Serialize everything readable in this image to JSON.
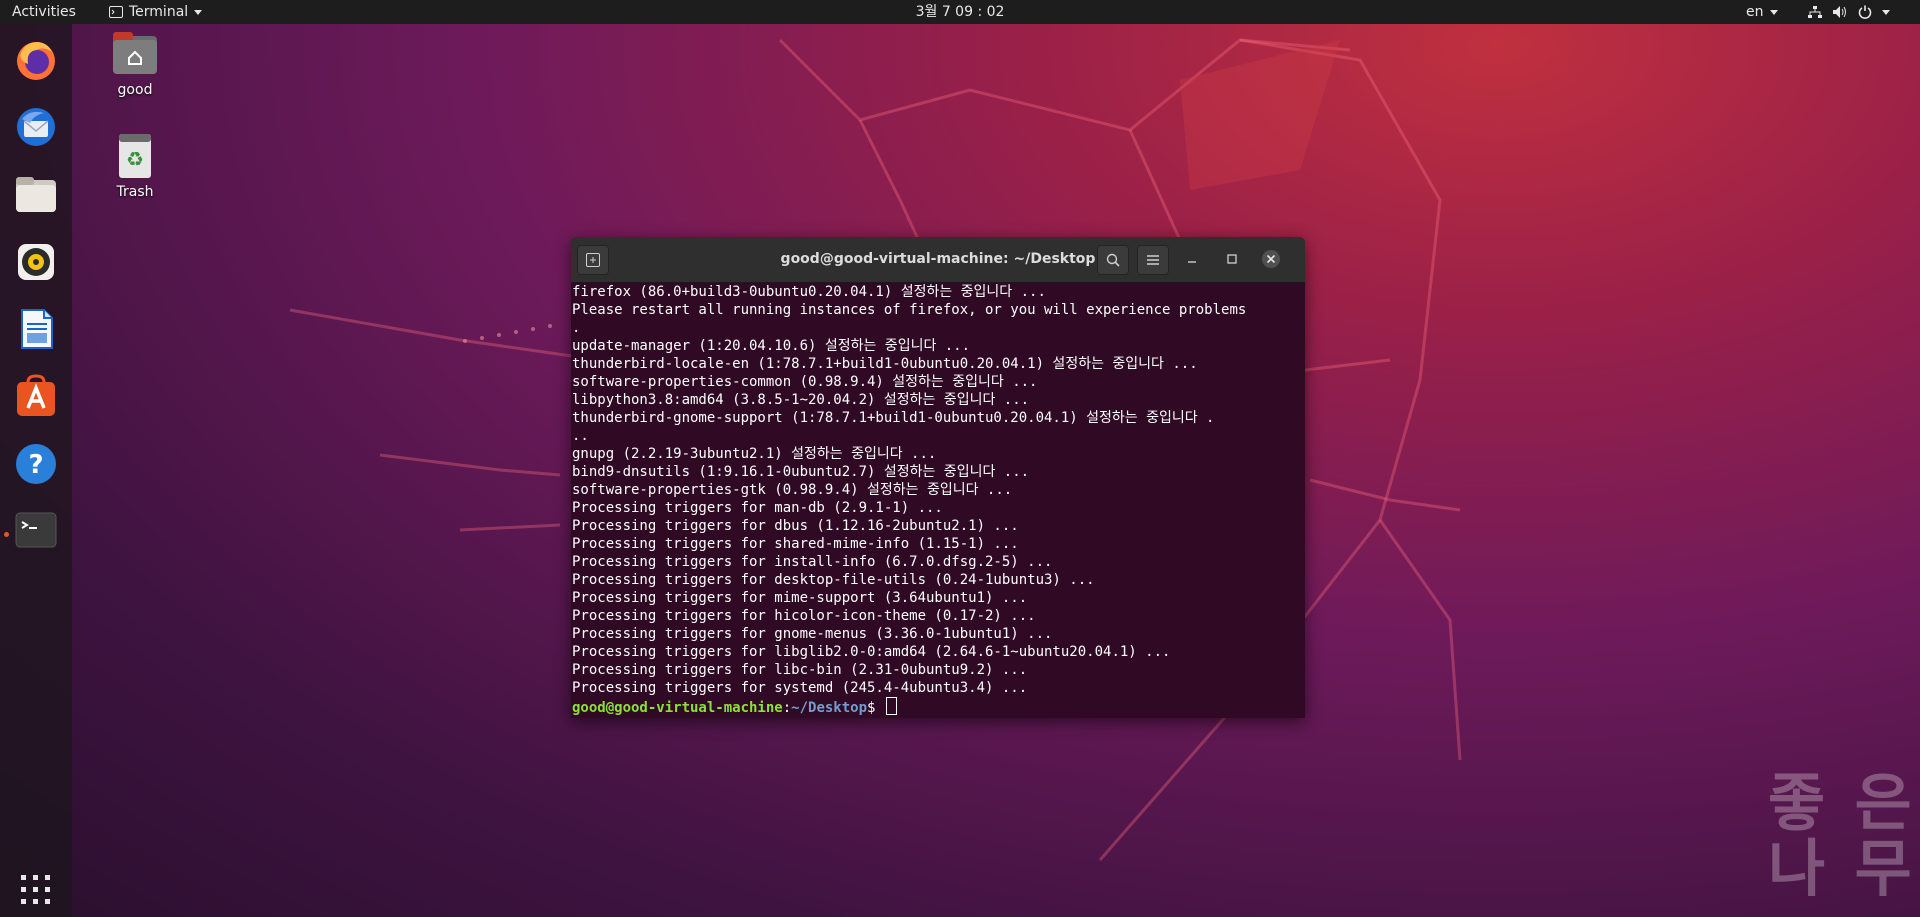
{
  "topbar": {
    "activities": "Activities",
    "app_menu": "Terminal",
    "clock": "3월 7 09 : 02",
    "lang": "en",
    "tray_icons": [
      "network-icon",
      "volume-icon",
      "power-icon"
    ]
  },
  "dock": {
    "items": [
      "firefox-icon",
      "thunderbird-icon",
      "files-icon",
      "rhythmbox-icon",
      "libreoffice-writer-icon",
      "software-center-icon",
      "help-icon",
      "terminal-icon"
    ],
    "show_apps": "show-apps-grid-icon",
    "accent": "#e95420"
  },
  "desktop": {
    "home_label": "good",
    "trash_label": "Trash"
  },
  "terminal": {
    "title": "good@good-virtual-machine: ~/Desktop",
    "lines": [
      "firefox (86.0+build3-0ubuntu0.20.04.1) 설정하는 중입니다 ...",
      "Please restart all running instances of firefox, or you will experience problems",
      ".",
      "update-manager (1:20.04.10.6) 설정하는 중입니다 ...",
      "thunderbird-locale-en (1:78.7.1+build1-0ubuntu0.20.04.1) 설정하는 중입니다 ...",
      "software-properties-common (0.98.9.4) 설정하는 중입니다 ...",
      "libpython3.8:amd64 (3.8.5-1~20.04.2) 설정하는 중입니다 ...",
      "thunderbird-gnome-support (1:78.7.1+build1-0ubuntu0.20.04.1) 설정하는 중입니다 .",
      "..",
      "gnupg (2.2.19-3ubuntu2.1) 설정하는 중입니다 ...",
      "bind9-dnsutils (1:9.16.1-0ubuntu2.7) 설정하는 중입니다 ...",
      "software-properties-gtk (0.98.9.4) 설정하는 중입니다 ...",
      "Processing triggers for man-db (2.9.1-1) ...",
      "Processing triggers for dbus (1.12.16-2ubuntu2.1) ...",
      "Processing triggers for shared-mime-info (1.15-1) ...",
      "Processing triggers for install-info (6.7.0.dfsg.2-5) ...",
      "Processing triggers for desktop-file-utils (0.24-1ubuntu3) ...",
      "Processing triggers for mime-support (3.64ubuntu1) ...",
      "Processing triggers for hicolor-icon-theme (0.17-2) ...",
      "Processing triggers for gnome-menus (3.36.0-1ubuntu1) ...",
      "Processing triggers for libglib2.0-0:amd64 (2.64.6-1~ubuntu20.04.1) ...",
      "Processing triggers for libc-bin (2.31-0ubuntu9.2) ...",
      "Processing triggers for systemd (245.4-4ubuntu3.4) ..."
    ],
    "prompt_user": "good@good-virtual-machine",
    "prompt_sep": ":",
    "prompt_path": "~/Desktop",
    "prompt_symbol": "$ "
  },
  "watermark": {
    "line1": "좋 은",
    "line2": "나 무"
  }
}
